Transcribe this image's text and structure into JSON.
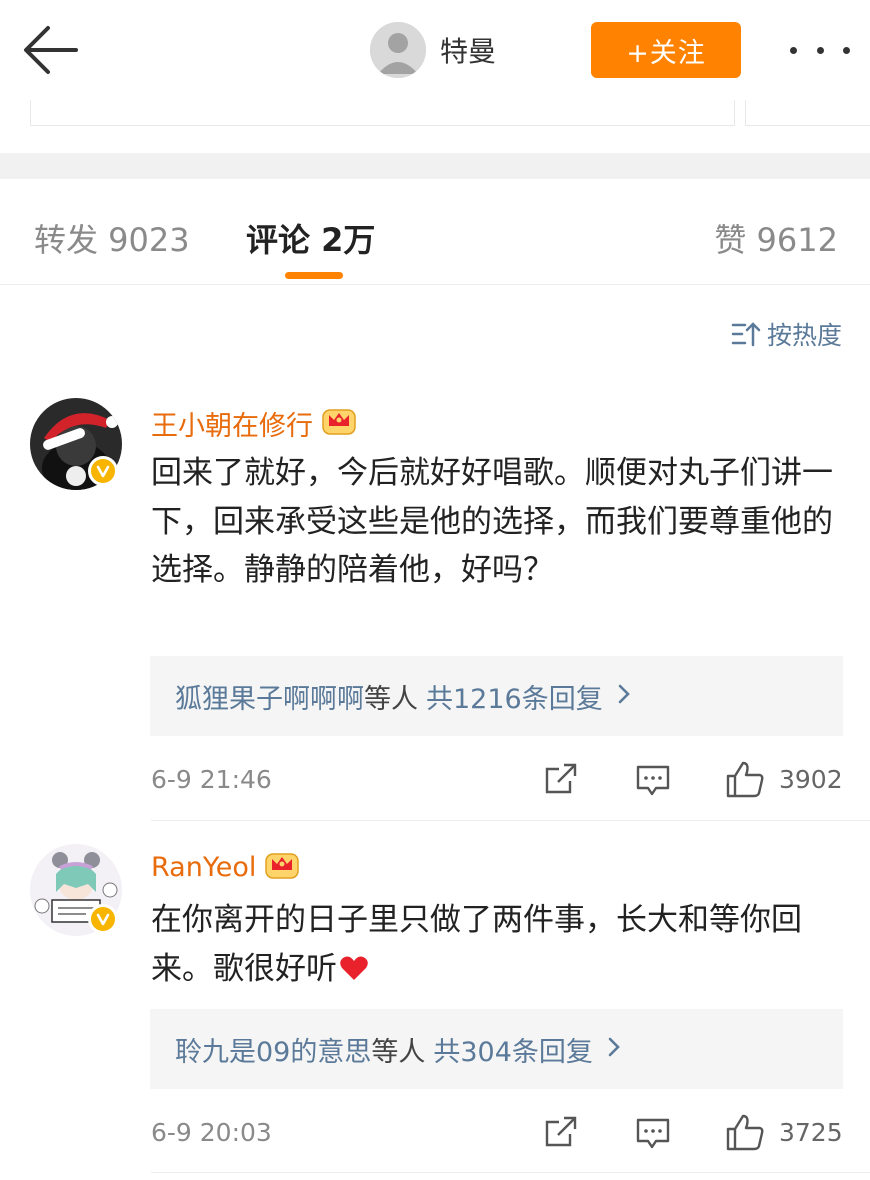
{
  "header": {
    "username": "特曼",
    "follow_label": "+关注",
    "icons": [
      "back-arrow-icon",
      "avatar-placeholder",
      "more-dots-icon"
    ]
  },
  "tabs": {
    "repost": "转发 9023",
    "comment": "评论 2万",
    "like": "赞 9612"
  },
  "sort_label": "按热度",
  "colors": {
    "accent": "#ff8200",
    "username": "#e86b0c",
    "link": "#5b7a99",
    "verify": "#f7b500",
    "heart": "#e8212a"
  },
  "comments": [
    {
      "name": "王小朝在修行",
      "text": "回来了就好，今后就好好唱歌。顺便对丸子们讲一下，回来承受这些是他的选择，而我们要尊重他的选择。静静的陪着他，好吗？",
      "reply_name": "狐狸果子啊啊啊",
      "reply_mid": "等人",
      "reply_count": "共1216条回复",
      "time": "6-9 21:46",
      "likes": "3902"
    },
    {
      "name": "RanYeol",
      "text": "在你离开的日子里只做了两件事，长大和等你回来。歌很好听",
      "reply_name": "聆九是09的意思",
      "reply_mid": "等人",
      "reply_count": "共304条回复",
      "time": "6-9 20:03",
      "likes": "3725"
    }
  ]
}
